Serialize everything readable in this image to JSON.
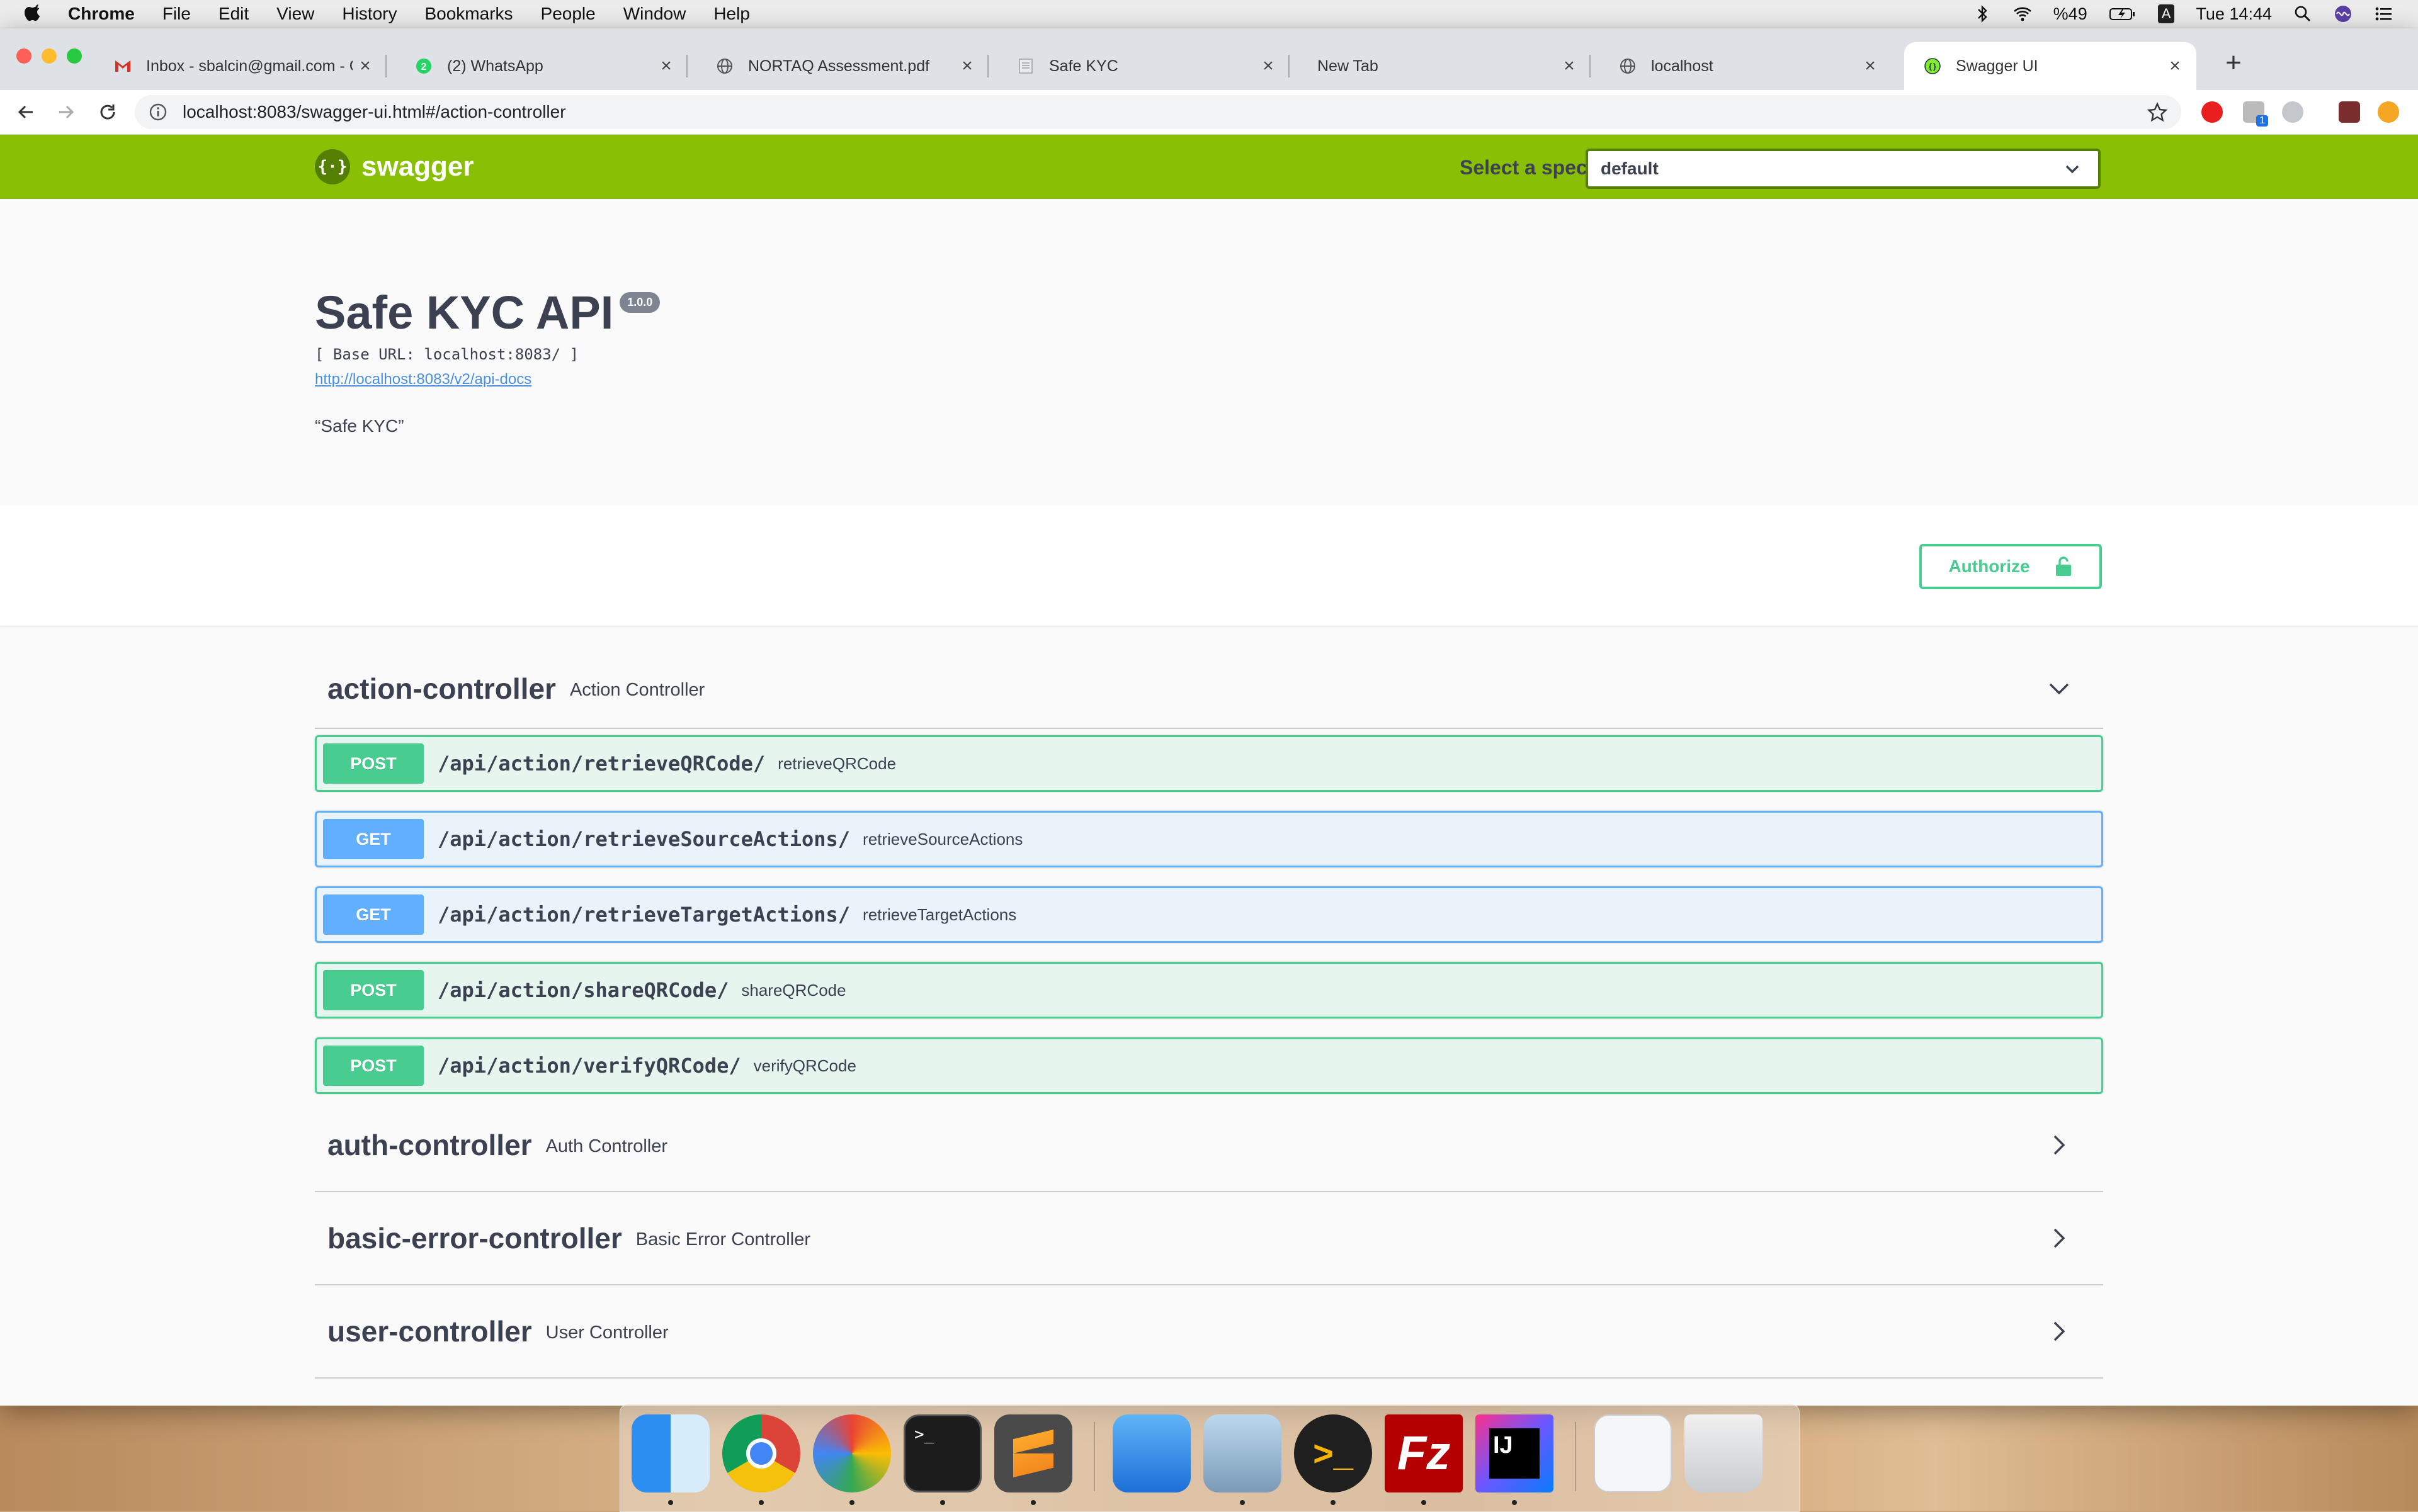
{
  "menubar": {
    "app": "Chrome",
    "items": [
      "File",
      "Edit",
      "View",
      "History",
      "Bookmarks",
      "People",
      "Window",
      "Help"
    ],
    "battery": "%49",
    "input_source": "A",
    "clock": "Tue 14:44"
  },
  "browser": {
    "tabs": [
      {
        "title": "Inbox - sbalcin@gmail.com - G",
        "icon": "gmail-icon"
      },
      {
        "title": "(2) WhatsApp",
        "icon": "whatsapp-icon",
        "badge": "2"
      },
      {
        "title": "NORTAQ Assessment.pdf",
        "icon": "globe-icon"
      },
      {
        "title": "Safe KYC",
        "icon": "document-icon"
      },
      {
        "title": "New Tab",
        "icon": ""
      },
      {
        "title": "localhost",
        "icon": "globe-icon"
      },
      {
        "title": "Swagger UI",
        "icon": "swagger-icon"
      }
    ],
    "active_tab_index": 6,
    "url": "localhost:8083/swagger-ui.html#/action-controller",
    "extension_badge": "1"
  },
  "swagger": {
    "brand": "swagger",
    "spec_label": "Select a spec",
    "spec_value": "default",
    "api_title": "Safe KYC API",
    "version": "1.0.0",
    "base_url": "[ Base URL: localhost:8083/ ]",
    "api_docs_link": "http://localhost:8083/v2/api-docs",
    "description": "“Safe KYC”",
    "authorize_label": "Authorize",
    "accent_color": "#89bf04",
    "post_color": "#49cc90",
    "get_color": "#61affe"
  },
  "tags": [
    {
      "name": "action-controller",
      "description": "Action Controller",
      "expanded": true,
      "operations": [
        {
          "method": "POST",
          "path": "/api/action/retrieveQRCode/",
          "summary": "retrieveQRCode"
        },
        {
          "method": "GET",
          "path": "/api/action/retrieveSourceActions/",
          "summary": "retrieveSourceActions"
        },
        {
          "method": "GET",
          "path": "/api/action/retrieveTargetActions/",
          "summary": "retrieveTargetActions"
        },
        {
          "method": "POST",
          "path": "/api/action/shareQRCode/",
          "summary": "shareQRCode"
        },
        {
          "method": "POST",
          "path": "/api/action/verifyQRCode/",
          "summary": "verifyQRCode"
        }
      ]
    },
    {
      "name": "auth-controller",
      "description": "Auth Controller",
      "expanded": false
    },
    {
      "name": "basic-error-controller",
      "description": "Basic Error Controller",
      "expanded": false
    },
    {
      "name": "user-controller",
      "description": "User Controller",
      "expanded": false
    }
  ],
  "dock": {
    "apps": [
      "finder-icon",
      "chrome-icon",
      "maps-pin-icon",
      "terminal-icon",
      "sublime-text-icon",
      "xcode-simulator-icon",
      "preview-icon",
      "prompt-icon",
      "filezilla-icon",
      "intellij-icon",
      "qr-code-app-icon",
      "trash-icon"
    ]
  }
}
